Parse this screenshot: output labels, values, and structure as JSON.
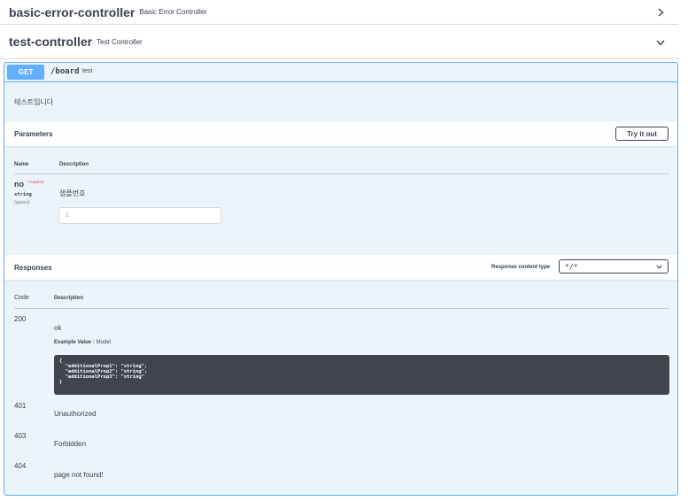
{
  "tags": [
    {
      "name": "basic-error-controller",
      "description": "Basic Error Controller"
    },
    {
      "name": "test-controller",
      "description": "Test Controller"
    }
  ],
  "operation": {
    "method": "GET",
    "path": "/board",
    "summary": "test",
    "description": "테스트입니다"
  },
  "parameters": {
    "title": "Parameters",
    "try_label": "Try it out",
    "col_name": "Name",
    "col_description": "Description",
    "items": [
      {
        "name": "no",
        "required": "* required",
        "type": "string",
        "in": "(query)",
        "description": "샘플번호",
        "input_value": "1"
      }
    ]
  },
  "responses": {
    "title": "Responses",
    "content_type_label": "Response content type",
    "content_type_value": "*/*",
    "col_code": "Code",
    "col_description": "Description",
    "example_tab": "Example Value",
    "model_tab": "Model",
    "example_lines": [
      "{",
      "  \"additionalProp1\": \"string\",",
      "  \"additionalProp2\": \"string\",",
      "  \"additionalProp3\": \"string\"",
      "}"
    ],
    "items": [
      {
        "code": "200",
        "description": "ok"
      },
      {
        "code": "401",
        "description": "Unauthorized"
      },
      {
        "code": "403",
        "description": "Forbidden"
      },
      {
        "code": "404",
        "description": "page not found!"
      }
    ]
  },
  "colors": {
    "get_accent": "#61affe",
    "opblock_bg": "#ebf3fb",
    "code_bg": "#41444e",
    "required": "#f93e3e"
  },
  "icons": {
    "collapsed_tag": "chevron-right-icon",
    "expanded_tag": "chevron-down-icon",
    "select": "chevron-down-icon"
  }
}
